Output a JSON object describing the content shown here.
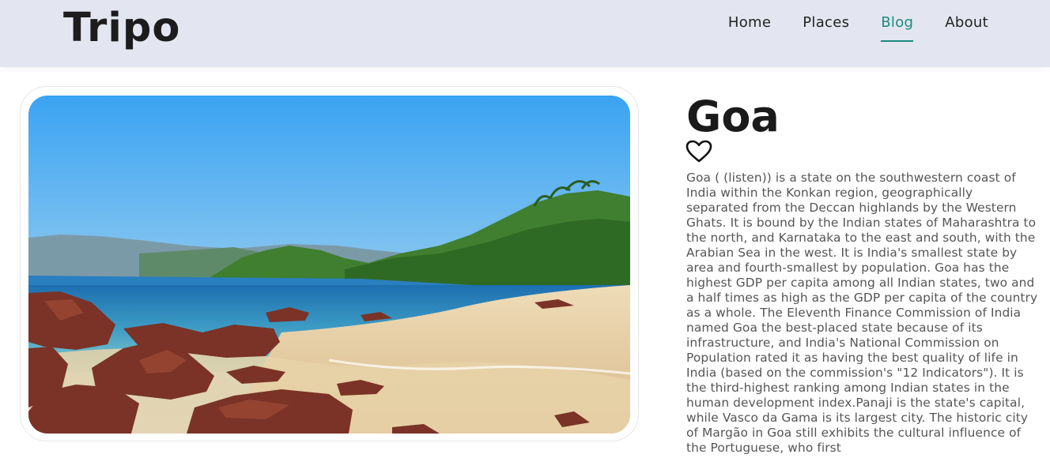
{
  "brand": {
    "name": "Tripo"
  },
  "nav": {
    "items": [
      {
        "label": "Home"
      },
      {
        "label": "Places"
      },
      {
        "label": "Blog"
      },
      {
        "label": "About"
      }
    ],
    "active": "Blog",
    "accent_color": "#1a8a7e"
  },
  "place": {
    "title": "Goa",
    "favorite_icon": "heart-outline-icon",
    "description": "Goa ( (listen)) is a state on the southwestern coast of India within the Konkan region, geographically separated from the Deccan highlands by the Western Ghats. It is bound by the Indian states of Maharashtra to the north, and Karnataka to the east and south, with the Arabian Sea in the west. It is India's smallest state by area and fourth-smallest by population. Goa has the highest GDP per capita among all Indian states, two and a half times as high as the GDP per capita of the country as a whole. The Eleventh Finance Commission of India named Goa the best-placed state because of its infrastructure, and India's National Commission on Population rated it as having the best quality of life in India (based on the commission's \"12 Indicators\"). It is the third-highest ranking among Indian states in the human development index.Panaji is the state's capital, while Vasco da Gama is its largest city. The historic city of Margão in Goa still exhibits the cultural influence of the Portuguese, who first"
  }
}
